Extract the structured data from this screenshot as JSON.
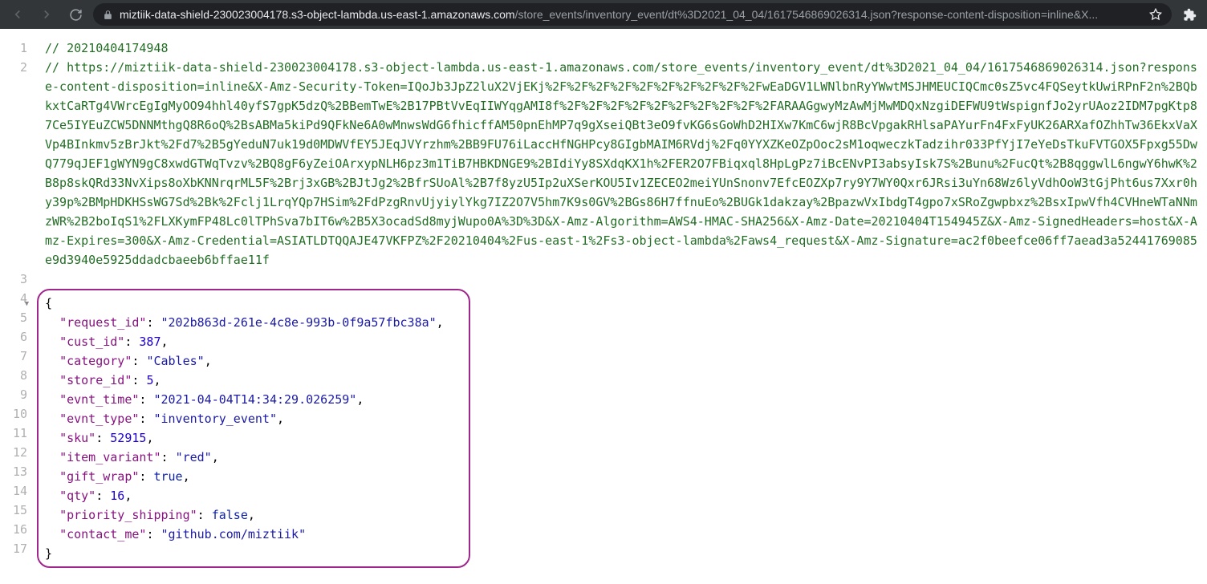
{
  "toolbar": {
    "url_host": "miztiik-data-shield-230023004178.s3-object-lambda.us-east-1.amazonaws.com",
    "url_path": "/store_events/inventory_event/dt%3D2021_04_04/1617546869026314.json?response-content-disposition=inline&X..."
  },
  "code": {
    "line1_comment": "// 20210404174948",
    "line2_comment_prefix": "// ",
    "line2_url": "https://miztiik-data-shield-230023004178.s3-object-lambda.us-east-1.amazonaws.com/store_events/inventory_event/dt%3D2021_04_04/1617546869026314.json?response-content-disposition=inline&X-Amz-Security-Token=IQoJb3JpZ2luX2VjEKj%2F%2F%2F%2F%2F%2F%2F%2F%2F%2FwEaDGV1LWNlbnRyYWwtMSJHMEUCIQCmc0sZ5vc4FQSeytkUwiRPnF2n%2BQbkxtCaRTg4VWrcEgIgMyOO94hhl40yfS7gpK5dzQ%2BBemTwE%2B17PBtVvEqIIWYqgAMI8f%2F%2F%2F%2F%2F%2F%2F%2F%2F%2FARAAGgwyMzAwMjMwMDQxNzgiDEFWU9tWspignfJo2yrUAoz2IDM7pgKtp87Ce5IYEuZCW5DNNMthgQ8R6oQ%2BsABMa5kiPd9QFkNe6A0wMnwsWdG6fhicffAM50pnEhMP7q9gXseiQBt3eO9fvKG6sGoWhD2HIXw7KmC6wjR8BcVpgakRHlsaPAYurFn4FxFyUK26ARXafOZhhTw36EkxVaXVp4BInkmv5zBrJkt%2Fd7%2B5gYeduN7uk19d0MDWVfEY5JEqJVYrzhm%2BB9FU76iLaccHfNGHPcy8GIgbMAIM6RVdj%2Fq0YYXZKeOZpOoc2sM1oqweczkTadzihr033PfYjI7eYeDsTkuFVTGOX5Fpxg55DwQ779qJEF1gWYN9gC8xwdGTWqTvzv%2BQ8gF6yZeiOArxypNLH6pz3m1TiB7HBKDNGE9%2BIdiYy8SXdqKX1h%2FER2O7FBiqxql8HpLgPz7iBcENvPI3absyIsk7S%2Bunu%2FucQt%2B8qggwlL6ngwY6hwK%2B8p8skQRd33NvXips8oXbKNNrqrML5F%2Brj3xGB%2BJtJg2%2BfrSUoAl%2B7f8yzU5Ip2uXSerKOU5Iv1ZECEO2meiYUnSnonv7EfcEOZXp7ry9Y7WY0Qxr6JRsi3uYn68Wz6lyVdhOoW3tGjPht6us7Xxr0hy39p%2BMpHDKHSsWG7Sd%2Bk%2Fclj1LrqYQp7HSim%2FdPzgRnvUjyiylYkg7IZ2O7V5hm7K9s0GV%2BGs86H7ffnuEo%2BUGk1dakzay%2BpazwVxIbdgT4gpo7xSRoZgwpbxz%2BsxIpwVfh4CVHneWTaNNmzWR%2B2boIqS1%2FLXKymFP48Lc0lTPhSva7bIT6w%2B5X3ocadSd8myjWupo0A%3D%3D&X-Amz-Algorithm=AWS4-HMAC-SHA256&X-Amz-Date=20210404T154945Z&X-Amz-SignedHeaders=host&X-Amz-Expires=300&X-Amz-Credential=ASIATLDTQQAJE47VKFPZ%2F20210404%2Fus-east-1%2Fs3-object-lambda%2Faws4_request&X-Amz-Signature=ac2f0beefce06ff7aead3a52441769085e9d3940e5925ddadcbaeeb6bffae11f",
    "gutter": [
      "1",
      "2",
      "3",
      "4",
      "5",
      "6",
      "7",
      "8",
      "9",
      "10",
      "11",
      "12",
      "13",
      "14",
      "15",
      "16",
      "17"
    ],
    "json_body": {
      "open_brace": "{",
      "close_brace": "}",
      "fields": [
        {
          "key": "\"request_id\"",
          "sep": ": ",
          "val": "\"202b863d-261e-4c8e-993b-0f9a57fbc38a\"",
          "type": "str",
          "comma": ","
        },
        {
          "key": "\"cust_id\"",
          "sep": ": ",
          "val": "387",
          "type": "num",
          "comma": ","
        },
        {
          "key": "\"category\"",
          "sep": ": ",
          "val": "\"Cables\"",
          "type": "str",
          "comma": ","
        },
        {
          "key": "\"store_id\"",
          "sep": ": ",
          "val": "5",
          "type": "num",
          "comma": ","
        },
        {
          "key": "\"evnt_time\"",
          "sep": ": ",
          "val": "\"2021-04-04T14:34:29.026259\"",
          "type": "str",
          "comma": ","
        },
        {
          "key": "\"evnt_type\"",
          "sep": ": ",
          "val": "\"inventory_event\"",
          "type": "str",
          "comma": ","
        },
        {
          "key": "\"sku\"",
          "sep": ": ",
          "val": "52915",
          "type": "num",
          "comma": ","
        },
        {
          "key": "\"item_variant\"",
          "sep": ": ",
          "val": "\"red\"",
          "type": "str",
          "comma": ","
        },
        {
          "key": "\"gift_wrap\"",
          "sep": ": ",
          "val": "true",
          "type": "bool",
          "comma": ","
        },
        {
          "key": "\"qty\"",
          "sep": ": ",
          "val": "16",
          "type": "num",
          "comma": ","
        },
        {
          "key": "\"priority_shipping\"",
          "sep": ": ",
          "val": "false",
          "type": "bool",
          "comma": ","
        },
        {
          "key": "\"contact_me\"",
          "sep": ": ",
          "val": "\"github.com/miztiik\"",
          "type": "str",
          "comma": ""
        }
      ]
    }
  }
}
